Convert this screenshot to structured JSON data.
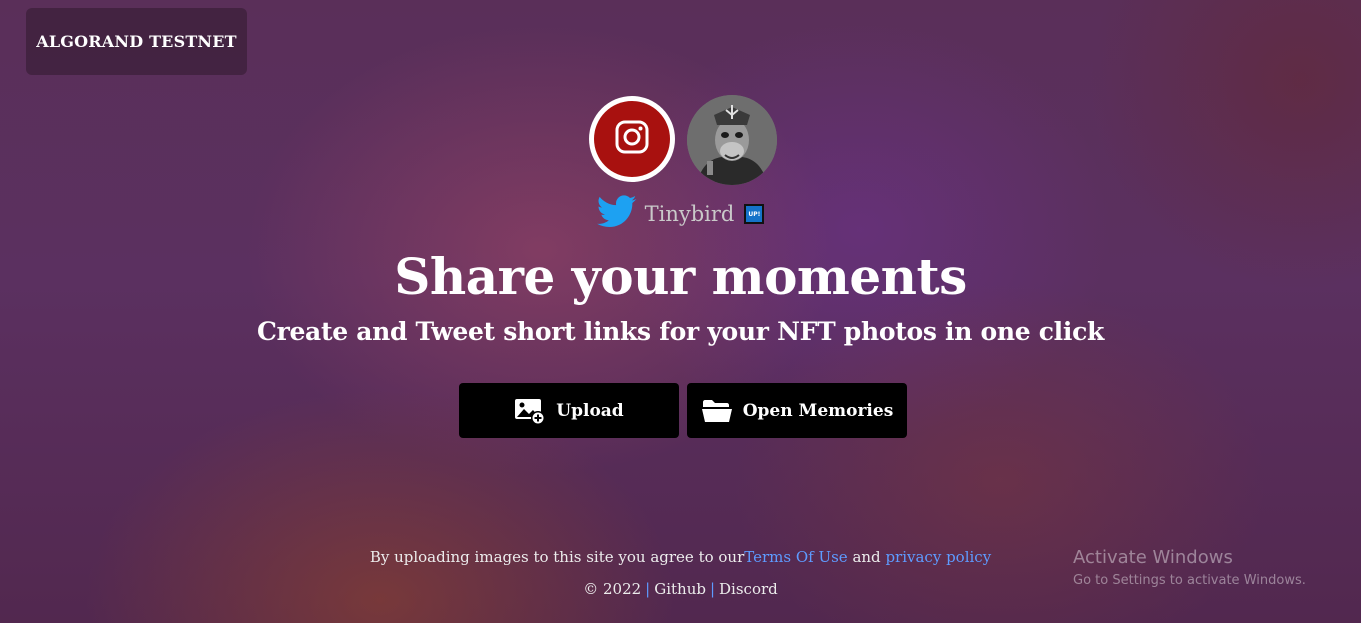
{
  "network": {
    "label": "ALGORAND TESTNET"
  },
  "profile": {
    "twitter_icon": "twitter-bird-icon",
    "name": "Tinybird",
    "badge": "UP!"
  },
  "hero": {
    "title": "Share your moments",
    "subtitle": "Create and Tweet short links for your NFT photos in one click"
  },
  "actions": {
    "upload_label": "Upload",
    "upload_icon": "image-add-icon",
    "memories_label": "Open Memories",
    "memories_icon": "folder-open-icon"
  },
  "legal": {
    "prefix": "By uploading images to this site you agree to our",
    "terms": "Terms Of Use",
    "and": " and ",
    "privacy": "privacy policy"
  },
  "footer": {
    "copyright": "© 2022",
    "separator": "|",
    "github": "Github",
    "discord": "Discord"
  },
  "watermark": {
    "title": "Activate Windows",
    "subtitle": "Go to Settings to activate Windows."
  },
  "colors": {
    "camera_button": "#a8110f",
    "link": "#5e9bff",
    "twitter": "#1da1f2",
    "button_bg": "#000000"
  }
}
